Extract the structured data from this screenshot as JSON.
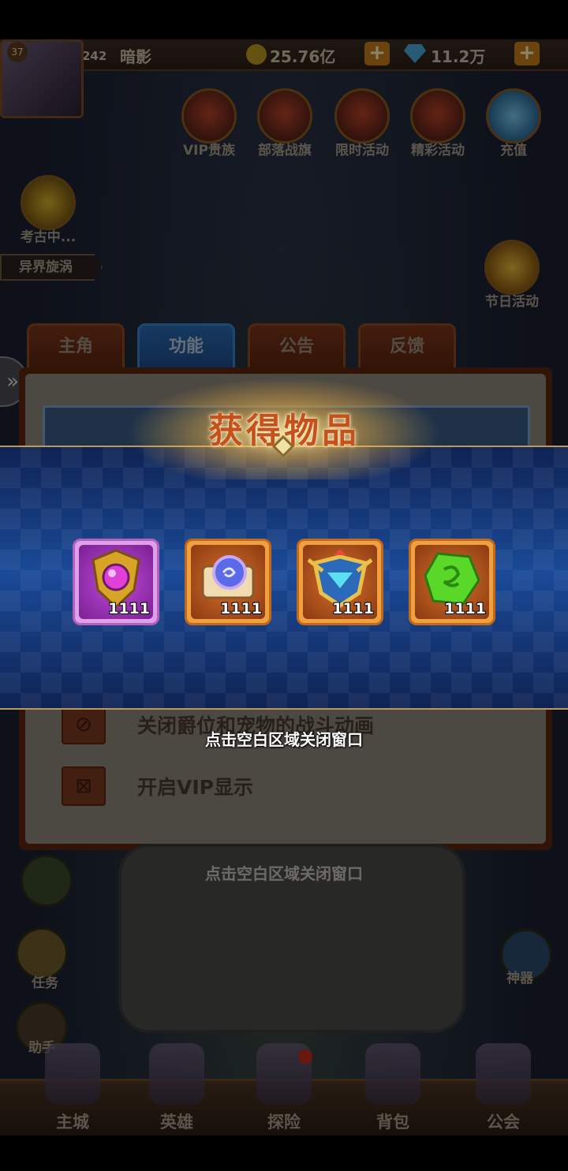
{
  "topbar": {
    "avatar_level": "37",
    "level": "242",
    "player_name": "暗影",
    "gold": "25.76亿",
    "gems": "11.2万",
    "plus_symbol": "+"
  },
  "activities": [
    {
      "label": "VIP贵族"
    },
    {
      "label": "部落战旗"
    },
    {
      "label": "限时活动"
    },
    {
      "label": "精彩活动"
    },
    {
      "label": "充值"
    }
  ],
  "left_widgets": {
    "archaeology_label": "考古中...",
    "banner_label": "异界旋涡"
  },
  "right_widgets": {
    "festival_label": "节日活动",
    "artifact_label": "神器"
  },
  "tabs": [
    {
      "label": "主角"
    },
    {
      "label": "功能"
    },
    {
      "label": "公告"
    },
    {
      "label": "反馈"
    }
  ],
  "settings": {
    "options": [
      {
        "label": "关闭爵位和宠物的战斗动画"
      },
      {
        "label": "开启VIP显示"
      }
    ]
  },
  "scene": {
    "close_hint_background": "点击空白区域关闭窗口",
    "quest_label": "任务",
    "helper_label": "助手"
  },
  "bottom_nav": [
    {
      "label": "主城"
    },
    {
      "label": "英雄"
    },
    {
      "label": "探险"
    },
    {
      "label": "背包"
    },
    {
      "label": "公会"
    }
  ],
  "reward": {
    "title": "获得物品",
    "close_hint": "点击空白区域关闭窗口",
    "items": [
      {
        "icon": "purple-gem-shield-icon",
        "count": "1111",
        "rarity": "purple"
      },
      {
        "icon": "scroll-orb-icon",
        "count": "1111",
        "rarity": "orange"
      },
      {
        "icon": "winged-crest-icon",
        "count": "1111",
        "rarity": "orange"
      },
      {
        "icon": "green-rune-stone-icon",
        "count": "1111",
        "rarity": "orange"
      }
    ]
  },
  "colors": {
    "title": "#c8501a",
    "band": "#1a4a98",
    "purple_frame": "#b060c0",
    "orange_frame": "#c06a1a"
  }
}
